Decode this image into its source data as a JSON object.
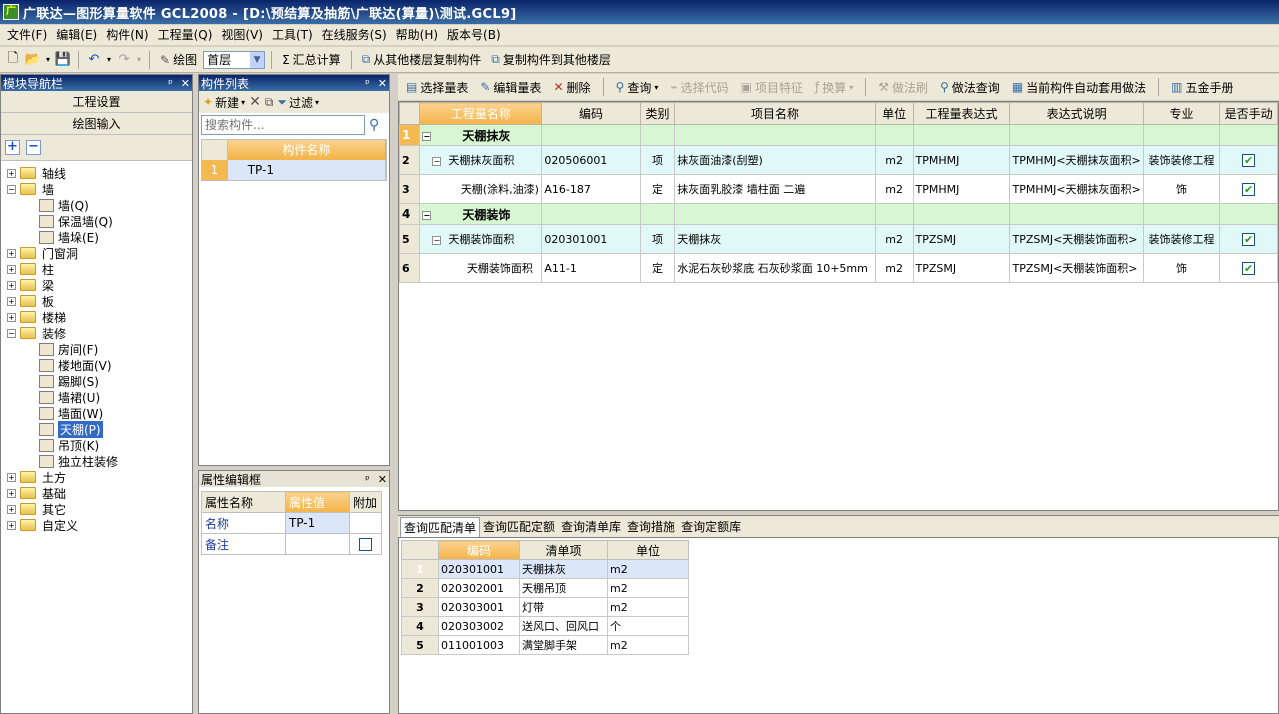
{
  "window": {
    "title": "广联达—图形算量软件 GCL2008 - [D:\\预结算及抽筋\\广联达(算量)\\测试.GCL9]"
  },
  "menu": [
    "文件(F)",
    "编辑(E)",
    "构件(N)",
    "工程量(Q)",
    "视图(V)",
    "工具(T)",
    "在线服务(S)",
    "帮助(H)",
    "版本号(B)"
  ],
  "toolbar": {
    "draw_label": "绘图",
    "floor_value": "首层",
    "sum_label": "汇总计算",
    "copy_from_label": "从其他楼层复制构件",
    "copy_to_label": "复制构件到其他楼层"
  },
  "nav": {
    "title": "模块导航栏",
    "project_settings": "工程设置",
    "draw_input": "绘图输入",
    "tree": [
      {
        "label": "轴线",
        "type": "folder",
        "level": 0,
        "expanded": false
      },
      {
        "label": "墙",
        "type": "folder",
        "level": 0,
        "expanded": true
      },
      {
        "label": "墙(Q)",
        "type": "leaf",
        "level": 1,
        "icon": "brick-wall-icon"
      },
      {
        "label": "保温墙(Q)",
        "type": "leaf",
        "level": 1,
        "icon": "insulation-wall-icon"
      },
      {
        "label": "墙垛(E)",
        "type": "leaf",
        "level": 1,
        "icon": "wall-pier-icon"
      },
      {
        "label": "门窗洞",
        "type": "folder",
        "level": 0,
        "expanded": false
      },
      {
        "label": "柱",
        "type": "folder",
        "level": 0,
        "expanded": false
      },
      {
        "label": "梁",
        "type": "folder",
        "level": 0,
        "expanded": false
      },
      {
        "label": "板",
        "type": "folder",
        "level": 0,
        "expanded": false
      },
      {
        "label": "楼梯",
        "type": "folder",
        "level": 0,
        "expanded": false
      },
      {
        "label": "装修",
        "type": "folder",
        "level": 0,
        "expanded": true
      },
      {
        "label": "房间(F)",
        "type": "leaf",
        "level": 1,
        "icon": "room-icon"
      },
      {
        "label": "楼地面(V)",
        "type": "leaf",
        "level": 1,
        "icon": "floor-icon"
      },
      {
        "label": "踢脚(S)",
        "type": "leaf",
        "level": 1,
        "icon": "skirting-icon"
      },
      {
        "label": "墙裙(U)",
        "type": "leaf",
        "level": 1,
        "icon": "dado-icon"
      },
      {
        "label": "墙面(W)",
        "type": "leaf",
        "level": 1,
        "icon": "wall-face-icon"
      },
      {
        "label": "天棚(P)",
        "type": "leaf",
        "level": 1,
        "icon": "ceiling-icon",
        "selected": true
      },
      {
        "label": "吊顶(K)",
        "type": "leaf",
        "level": 1,
        "icon": "suspended-ceiling-icon"
      },
      {
        "label": "独立柱装修",
        "type": "leaf",
        "level": 1,
        "icon": "column-decoration-icon"
      },
      {
        "label": "土方",
        "type": "folder",
        "level": 0,
        "expanded": false
      },
      {
        "label": "基础",
        "type": "folder",
        "level": 0,
        "expanded": false
      },
      {
        "label": "其它",
        "type": "folder",
        "level": 0,
        "expanded": false
      },
      {
        "label": "自定义",
        "type": "folder",
        "level": 0,
        "expanded": false
      }
    ]
  },
  "complist": {
    "title": "构件列表",
    "new_label": "新建",
    "filter_label": "过滤",
    "search_placeholder": "搜索构件...",
    "col_name": "构件名称",
    "rows": [
      {
        "n": "1",
        "name": "TP-1"
      }
    ]
  },
  "props": {
    "title": "属性编辑框",
    "col_name": "属性名称",
    "col_value": "属性值",
    "col_extra": "附加",
    "rows": [
      {
        "name": "名称",
        "value": "TP-1",
        "has_checkbox": false
      },
      {
        "name": "备注",
        "value": "",
        "has_checkbox": true
      }
    ]
  },
  "rtoolbar": {
    "select_list": "选择量表",
    "edit_list": "编辑量表",
    "delete": "删除",
    "query": "查询",
    "select_code": "选择代码",
    "item_features": "项目特征",
    "convert": "换算",
    "method_brush": "做法刷",
    "method_query": "做法查询",
    "auto_apply": "当前构件自动套用做法",
    "hardware_manual": "五金手册"
  },
  "main_grid": {
    "headers": [
      "",
      "工程量名称",
      "编码",
      "类别",
      "项目名称",
      "单位",
      "工程量表达式",
      "表达式说明",
      "专业",
      "是否手动"
    ],
    "rows": [
      {
        "n": "1",
        "kind": "grp",
        "name": "天棚抹灰"
      },
      {
        "n": "2",
        "kind": "item",
        "name": "天棚抹灰面积",
        "code": "020506001",
        "cat": "项",
        "proj": "抹灰面油漆(刮塑)",
        "unit": "m2",
        "expr": "TPMHMJ",
        "desc": "TPMHMJ<天棚抹灰面积>",
        "major": "装饰装修工程",
        "manual": true
      },
      {
        "n": "3",
        "kind": "quota",
        "name": "天棚(涂料,油漆)",
        "code": "A16-187",
        "cat": "定",
        "proj": "抹灰面乳胶漆  墙柱面 二遍",
        "unit": "m2",
        "expr": "TPMHMJ",
        "desc": "TPMHMJ<天棚抹灰面积>",
        "major": "饰",
        "manual": true
      },
      {
        "n": "4",
        "kind": "grp",
        "name": "天棚装饰"
      },
      {
        "n": "5",
        "kind": "item",
        "name": "天棚装饰面积",
        "code": "020301001",
        "cat": "项",
        "proj": "天棚抹灰",
        "unit": "m2",
        "expr": "TPZSMJ",
        "desc": "TPZSMJ<天棚装饰面积>",
        "major": "装饰装修工程",
        "manual": true
      },
      {
        "n": "6",
        "kind": "quota",
        "name": "天棚装饰面积",
        "code": "A11-1",
        "cat": "定",
        "proj": "水泥石灰砂浆底 石灰砂浆面 10+5mm",
        "unit": "m2",
        "expr": "TPZSMJ",
        "desc": "TPZSMJ<天棚装饰面积>",
        "major": "饰",
        "manual": true
      }
    ]
  },
  "bottom_tabs": [
    "查询匹配清单",
    "查询匹配定额",
    "查询清单库",
    "查询措施",
    "查询定额库"
  ],
  "bottom_grid": {
    "headers": [
      "",
      "编码",
      "清单项",
      "单位"
    ],
    "rows": [
      {
        "n": "1",
        "code": "020301001",
        "item": "天棚抹灰",
        "unit": "m2"
      },
      {
        "n": "2",
        "code": "020302001",
        "item": "天棚吊顶",
        "unit": "m2"
      },
      {
        "n": "3",
        "code": "020303001",
        "item": "灯带",
        "unit": "m2"
      },
      {
        "n": "4",
        "code": "020303002",
        "item": "送风口、回风口",
        "unit": "个"
      },
      {
        "n": "5",
        "code": "011001003",
        "item": "满堂脚手架",
        "unit": "m2"
      }
    ]
  }
}
